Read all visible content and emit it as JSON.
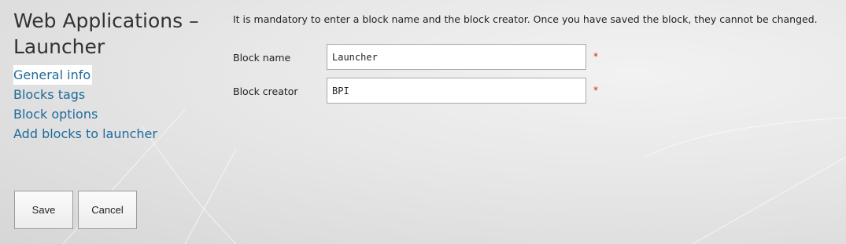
{
  "page": {
    "title": "Web Applications – Launcher"
  },
  "nav": {
    "items": [
      {
        "label": "General info",
        "active": true
      },
      {
        "label": "Blocks tags",
        "active": false
      },
      {
        "label": "Block options",
        "active": false
      },
      {
        "label": "Add blocks to launcher",
        "active": false
      }
    ]
  },
  "form": {
    "info": "It is mandatory to enter a block name and the block creator. Once you have saved the block, they cannot be changed.",
    "block_name": {
      "label": "Block name",
      "value": "Launcher",
      "required_mark": "*"
    },
    "block_creator": {
      "label": "Block creator",
      "value": "BPI",
      "required_mark": "*"
    }
  },
  "buttons": {
    "save": "Save",
    "cancel": "Cancel"
  }
}
